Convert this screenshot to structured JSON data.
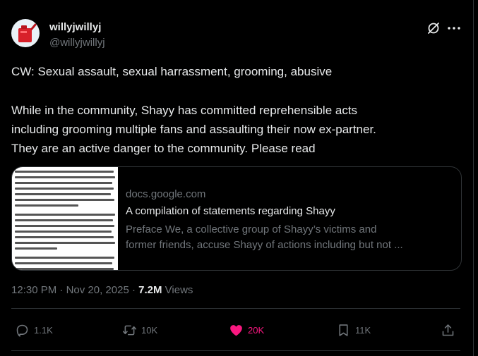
{
  "author": {
    "display_name": "willyjwillyj",
    "handle": "@willyjwillyj"
  },
  "tweet": {
    "cw_line": "CW: Sexual assault, sexual harrassment, grooming, abusive",
    "body_lines": [
      "While in the community, Shayy has committed reprehensible acts",
      "including grooming multiple fans and assaulting their now ex-partner.",
      "They are an active danger to the community. Please read"
    ]
  },
  "link_card": {
    "domain": "docs.google.com",
    "title": "A compilation of statements regarding Shayy",
    "description_lines": [
      "Preface We, a collective group of Shayy’s victims and",
      "former friends, accuse Shayy of actions including but not ..."
    ]
  },
  "meta": {
    "time": "12:30 PM",
    "separator": "·",
    "date": "Nov 20, 2025",
    "views_count": "7.2M",
    "views_label": "Views"
  },
  "actions": {
    "replies": "1.1K",
    "reposts": "10K",
    "likes": "20K",
    "bookmarks": "11K"
  },
  "icons": {
    "avatar": "red-gas-can-avatar",
    "grok": "grok-icon",
    "more": "more-icon",
    "reply": "reply-icon",
    "repost": "repost-icon",
    "like": "heart-icon",
    "bookmark": "bookmark-icon",
    "share": "share-icon"
  },
  "colors": {
    "background": "#000000",
    "text": "#e7e9ea",
    "secondary": "#71767b",
    "like_active": "#f91880",
    "border": "#2f3336"
  }
}
